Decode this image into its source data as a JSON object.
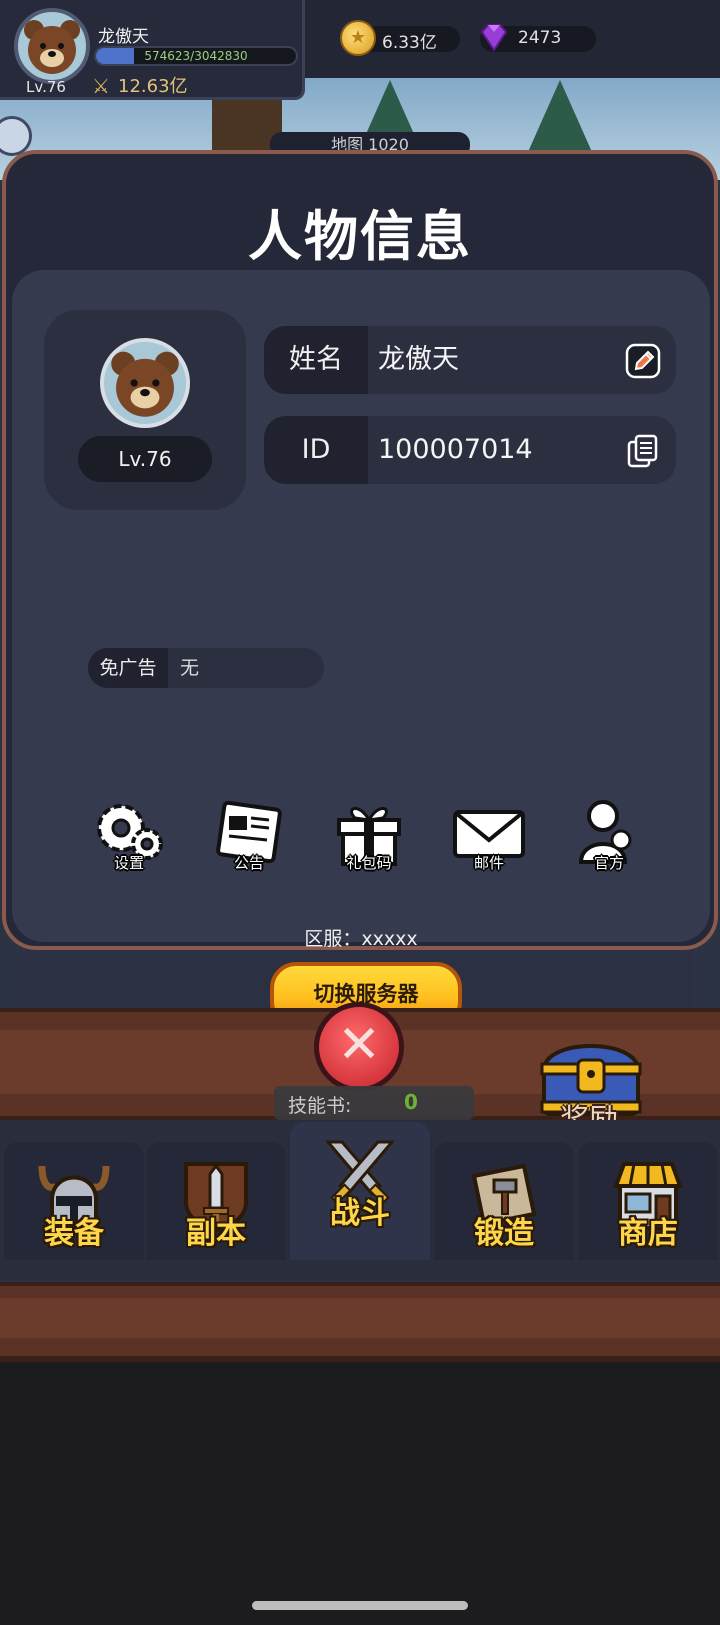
{
  "player": {
    "name": "龙傲天",
    "level": "Lv.76",
    "xp": "574623/3042830",
    "xp_fraction": 0.19,
    "power": "12.63亿"
  },
  "currency": {
    "coins": "6.33亿",
    "gems": "2473"
  },
  "background": {
    "map_label": "地图 1020"
  },
  "modal": {
    "title": "人物信息",
    "avatar_level": "Lv.76",
    "name_label": "姓名",
    "name_value": "龙傲天",
    "id_label": "ID",
    "id_value": "100007014",
    "no_ads_label": "免广告",
    "no_ads_value": "无",
    "menu": [
      {
        "label": "设置",
        "icon": "gear-icon"
      },
      {
        "label": "公告",
        "icon": "announcement-icon"
      },
      {
        "label": "礼包码",
        "icon": "gift-icon"
      },
      {
        "label": "邮件",
        "icon": "mail-icon"
      },
      {
        "label": "官方",
        "icon": "official-icon"
      }
    ],
    "server_text": "区服：xxxxx",
    "switch_server_button": "切换服务器"
  },
  "bottom": {
    "skill_book_label": "技能书:",
    "skill_book_value": "0",
    "reward_label": "奖励",
    "nav": [
      {
        "label": "装备",
        "icon": "helmet-icon"
      },
      {
        "label": "副本",
        "icon": "dungeon-icon"
      },
      {
        "label": "战斗",
        "icon": "crossed-swords-icon"
      },
      {
        "label": "锻造",
        "icon": "forge-scroll-icon"
      },
      {
        "label": "商店",
        "icon": "shop-icon"
      }
    ]
  },
  "colors": {
    "modal_border": "#8a5a4c",
    "button_gold": "#ffc020",
    "nav_label": "#ffd64a"
  }
}
